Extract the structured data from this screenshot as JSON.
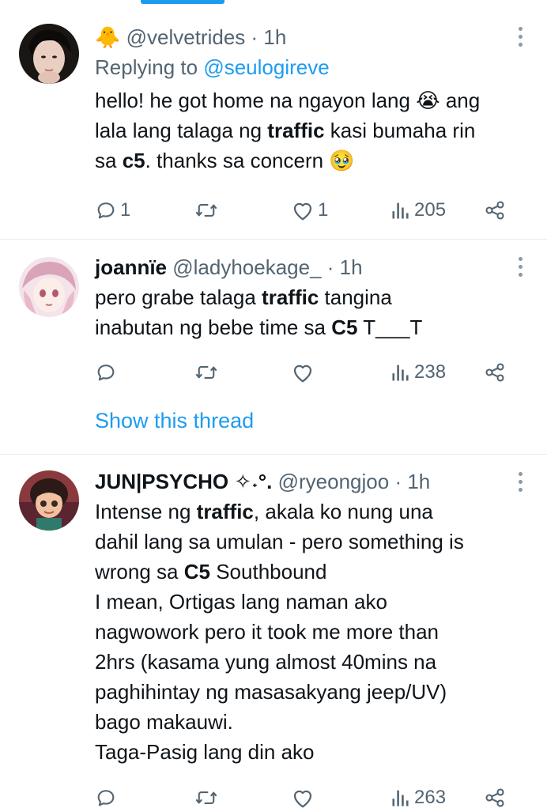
{
  "tweets": [
    {
      "emoji": "🐥",
      "name": "",
      "handle": "@velvetrides",
      "time": "· 1h",
      "replying_prefix": "Replying to",
      "replying_handle": "@seulogireve",
      "lines": [
        [
          "hello! he got home na ngayon lang ",
          {
            "emoji": "😭"
          },
          " ang"
        ],
        [
          "lala lang talaga ng ",
          {
            "b": "traffic"
          },
          " kasi bumaha rin"
        ],
        [
          "sa ",
          {
            "b": "c5"
          },
          ". thanks sa concern ",
          {
            "emoji": "🥹"
          }
        ]
      ],
      "stats": {
        "replies": "1",
        "reposts": "",
        "likes": "1",
        "views": "205"
      }
    },
    {
      "name": "joannïe",
      "handle": "@ladyhoekage_",
      "time": "· 1h",
      "lines": [
        [
          "pero grabe talaga ",
          {
            "b": "traffic"
          },
          " tangina"
        ],
        [
          "inabutan ng bebe time sa ",
          {
            "b": "C5"
          },
          " T___T"
        ]
      ],
      "stats": {
        "replies": "",
        "reposts": "",
        "likes": "",
        "views": "238"
      },
      "show_thread": "Show this thread"
    },
    {
      "name": "JUN|PSYCHO ✧˖°.",
      "handle": "@ryeongjoo",
      "time": "· 1h",
      "lines": [
        [
          "Intense ng ",
          {
            "b": "traffic"
          },
          ", akala ko nung una"
        ],
        [
          "dahil lang sa umulan - pero something is"
        ],
        [
          "wrong sa ",
          {
            "b": "C5"
          },
          " Southbound"
        ],
        [
          "I mean, Ortigas lang naman ako"
        ],
        [
          "nagwowork pero it took me more than"
        ],
        [
          "2hrs (kasama yung almost 40mins na"
        ],
        [
          "paghihintay ng masasakyang jeep/UV)"
        ],
        [
          "bago makauwi."
        ],
        [
          "Taga-Pasig lang din ako"
        ]
      ],
      "stats": {
        "replies": "",
        "reposts": "",
        "likes": "",
        "views": "263"
      }
    }
  ],
  "colors": {
    "accent": "#1d9bf0",
    "muted": "#536471",
    "text": "#0f1419",
    "divider": "#e6e9ec"
  },
  "icons": [
    "reply-icon",
    "repost-icon",
    "like-icon",
    "views-icon",
    "share-icon",
    "more-icon"
  ]
}
